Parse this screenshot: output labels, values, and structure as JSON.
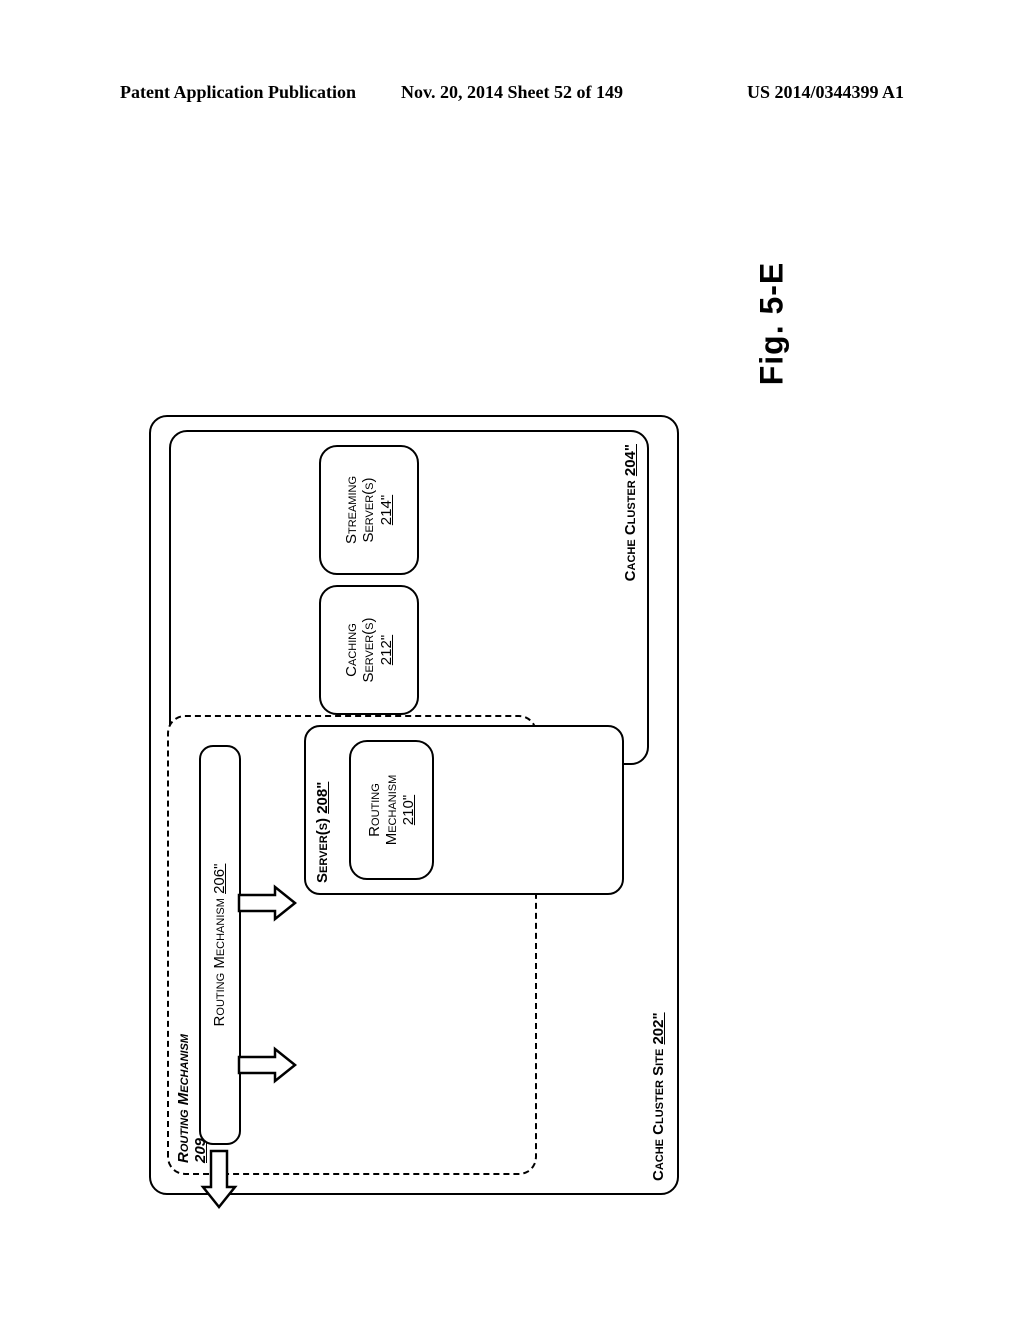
{
  "header": {
    "left": "Patent Application Publication",
    "center": "Nov. 20, 2014  Sheet 52 of 149",
    "right": "US 2014/0344399 A1"
  },
  "figure": {
    "title": "Fig. 5-E"
  },
  "diagram": {
    "site": {
      "name": "Cache Cluster Site",
      "ref": "202\""
    },
    "cluster": {
      "name": "Cache Cluster",
      "ref": "204\""
    },
    "routing_mech_group": {
      "name": "Routing Mechanism",
      "ref": "209"
    },
    "routing_mech_main": {
      "name": "Routing Mechanism",
      "ref": "206\""
    },
    "servers": {
      "name": "Server(s)",
      "ref": "208\""
    },
    "routing_mech_inner": {
      "name": "Routing",
      "name2": "Mechanism",
      "ref": "210\""
    },
    "caching": {
      "name": "Caching",
      "name2": "Server(s)",
      "ref": "212\""
    },
    "streaming": {
      "name": "Streaming",
      "name2": "Server(s)",
      "ref": "214\""
    }
  }
}
